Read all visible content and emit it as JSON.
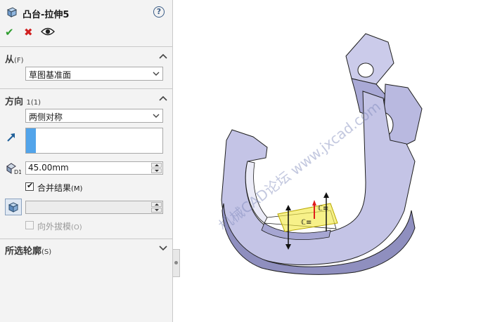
{
  "property_manager": {
    "feature_icon": "extrude-feature-icon",
    "title": "凸台-拉伸5",
    "help_icon": "help-icon",
    "help_glyph": "?",
    "actions": {
      "ok_icon": "checkmark-icon",
      "ok_glyph": "✔",
      "cancel_icon": "close-icon",
      "cancel_glyph": "✖",
      "preview_icon": "eye-icon",
      "ok_color": "#2e9d2e",
      "cancel_color": "#d02020"
    }
  },
  "from_section": {
    "title": "从",
    "suffix": "(F)",
    "selected": "草图基准面"
  },
  "direction_section": {
    "title": "方向",
    "suffix": "1(1)",
    "end_condition": "两侧对称",
    "reverse_icon": "reverse-direction-arrow-icon",
    "depth_icon": "depth-dimension-icon",
    "depth_value": "45.00mm",
    "merge_result": {
      "checked": true,
      "label": "合并结果",
      "suffix": "(M)",
      "check_glyph": "✔"
    },
    "draft_icon": "draft-toggle-icon",
    "draft_value": "",
    "draft_outward": {
      "checked": false,
      "enabled": false,
      "label": "向外拔模",
      "suffix": "(O)"
    }
  },
  "selected_contours_section": {
    "title": "所选轮廓",
    "suffix": "(S)"
  },
  "viewport": {
    "watermark": "机械CAD论坛 www.jxcad.com",
    "model_colors": {
      "face": "#c4c4e6",
      "shade": "#8f8fbf",
      "edge": "#1e1e1e",
      "preview": "#f2e94a"
    }
  }
}
